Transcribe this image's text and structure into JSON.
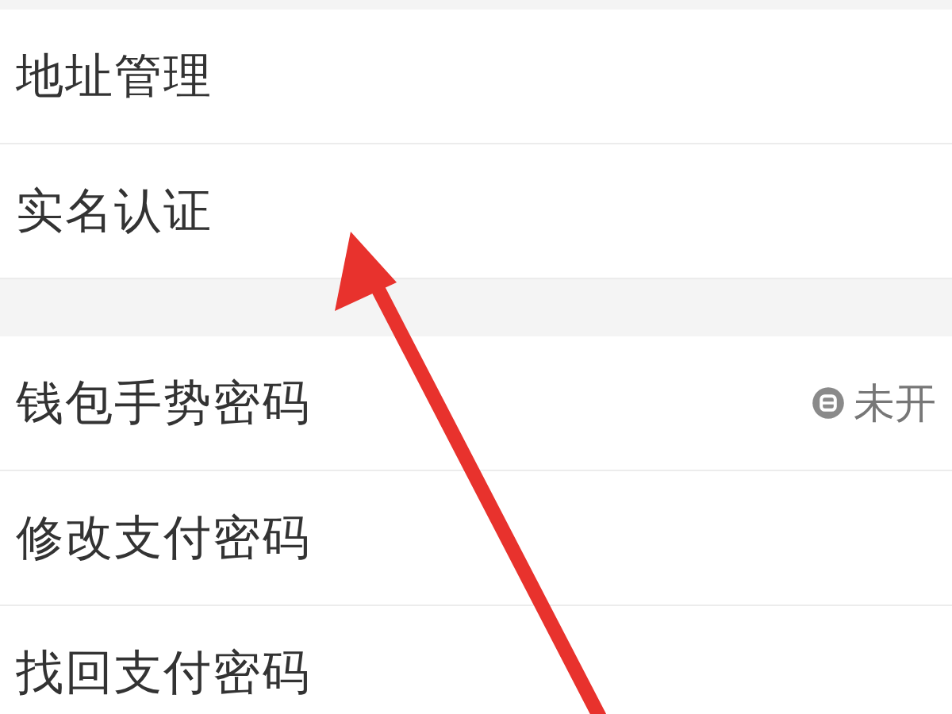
{
  "groups": [
    {
      "rows": [
        {
          "label": "地址管理"
        },
        {
          "label": "实名认证"
        }
      ]
    },
    {
      "rows": [
        {
          "label": "钱包手势密码",
          "status": {
            "kind": "locked",
            "text": "未开"
          }
        },
        {
          "label": "修改支付密码"
        },
        {
          "label": "找回支付密码"
        }
      ]
    }
  ]
}
